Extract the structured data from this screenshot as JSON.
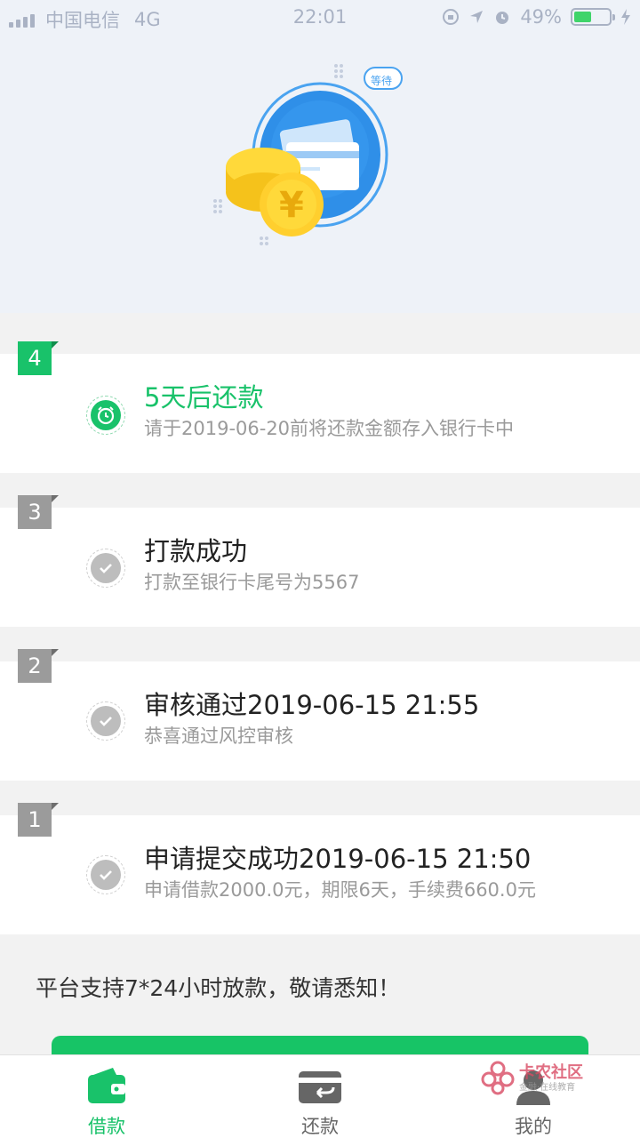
{
  "status_bar": {
    "carrier": "中国电信",
    "network": "4G",
    "time": "22:01",
    "battery": "49%",
    "battery_level": 0.49
  },
  "hero": {
    "badge_text": "等待",
    "coin_symbol": "¥"
  },
  "steps": [
    {
      "number": "4",
      "title": "5天后还款",
      "desc": "请于2019-06-20前将还款金额存入银行卡中",
      "state": "active",
      "icon": "alarm-clock-icon"
    },
    {
      "number": "3",
      "title": "打款成功",
      "desc": "打款至银行卡尾号为5567",
      "state": "done",
      "icon": "check-icon"
    },
    {
      "number": "2",
      "title": "审核通过2019-06-15 21:55",
      "desc": "恭喜通过风控审核",
      "state": "done",
      "icon": "check-icon"
    },
    {
      "number": "1",
      "title": "申请提交成功2019-06-15 21:50",
      "desc": "申请借款2000.0元，期限6天，手续费660.0元",
      "state": "done",
      "icon": "check-icon"
    }
  ],
  "notice": "平台支持7*24小时放款，敬请悉知！",
  "tabs": [
    {
      "label": "借款",
      "icon": "wallet-icon",
      "active": true
    },
    {
      "label": "还款",
      "icon": "repay-card-icon",
      "active": false
    },
    {
      "label": "我的",
      "icon": "user-icon",
      "active": false
    }
  ],
  "watermark": {
    "title": "卡农社区",
    "subtitle": "金融·在线教育"
  },
  "colors": {
    "accent": "#19c26a",
    "inactive": "#9b9b9b",
    "hero_bg": "#eef2f8"
  }
}
